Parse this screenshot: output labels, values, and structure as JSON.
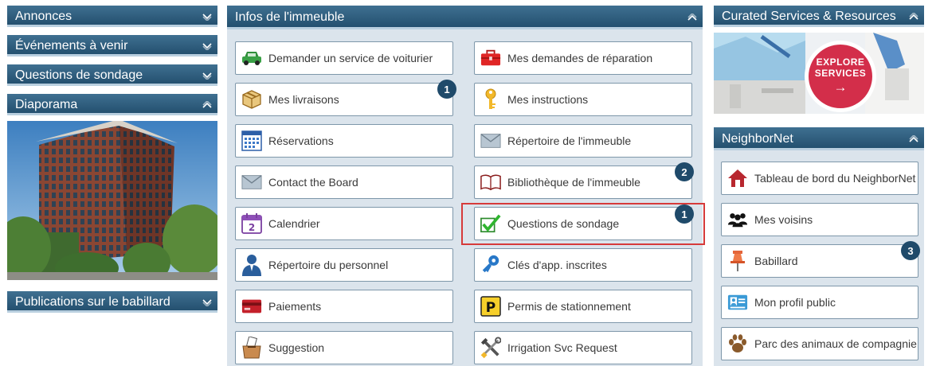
{
  "left": {
    "headers": [
      "Annonces",
      "Événements à venir",
      "Questions de sondage",
      "Diaporama",
      "Publications sur le babillard"
    ]
  },
  "infos": {
    "title": "Infos de l'immeuble",
    "tiles": [
      {
        "label": "Demander un service de voiturier",
        "icon": "car-icon"
      },
      {
        "label": "Mes demandes de réparation",
        "icon": "toolbox-icon"
      },
      {
        "label": "Mes livraisons",
        "icon": "package-icon",
        "badge": "1"
      },
      {
        "label": "Mes instructions",
        "icon": "key-icon"
      },
      {
        "label": "Réservations",
        "icon": "calendar-grid-icon"
      },
      {
        "label": "Répertoire de l'immeuble",
        "icon": "envelope-icon"
      },
      {
        "label": "Contact the Board",
        "icon": "envelope-icon"
      },
      {
        "label": "Bibliothèque de l'immeuble",
        "icon": "book-icon",
        "badge": "2"
      },
      {
        "label": "Calendrier",
        "icon": "calendar-icon"
      },
      {
        "label": "Questions de sondage",
        "icon": "checkmark-icon",
        "badge": "1"
      },
      {
        "label": "Répertoire du personnel",
        "icon": "person-icon"
      },
      {
        "label": "Clés d'app. inscrites",
        "icon": "key-fob-icon"
      },
      {
        "label": "Paiements",
        "icon": "credit-card-icon"
      },
      {
        "label": "Permis de stationnement",
        "icon": "parking-icon"
      },
      {
        "label": "Suggestion",
        "icon": "ballot-box-icon"
      },
      {
        "label": "Irrigation Svc Request",
        "icon": "tools-icon"
      }
    ]
  },
  "curated": {
    "title": "Curated Services & Resources",
    "cta_line1": "EXPLORE",
    "cta_line2": "SERVICES",
    "cta_arrow": "→"
  },
  "neighbornet": {
    "title": "NeighborNet",
    "tiles": [
      {
        "label": "Tableau de bord du NeighborNet",
        "icon": "house-icon"
      },
      {
        "label": "Mes voisins",
        "icon": "people-icon"
      },
      {
        "label": "Babillard",
        "icon": "pushpin-icon",
        "badge": "3"
      },
      {
        "label": "Mon profil public",
        "icon": "profile-card-icon"
      },
      {
        "label": "Parc des animaux de compagnie",
        "icon": "paw-icon"
      }
    ]
  },
  "colors": {
    "header_bg": "#2d5b7c",
    "panel_bg": "#dbe4ec",
    "badge_bg": "#1f4a6a",
    "highlight": "#d63a3a",
    "cta_red": "#d32e4a"
  }
}
